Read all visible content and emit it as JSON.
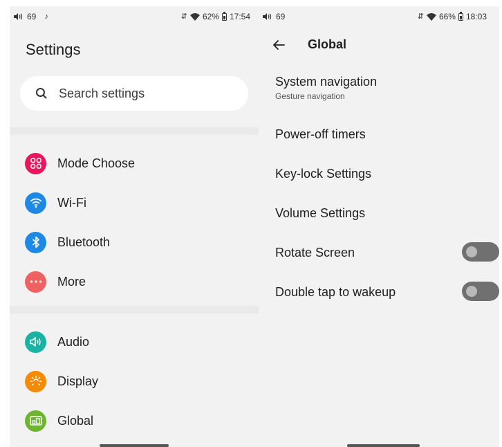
{
  "left_screen": {
    "status": {
      "volume": "69",
      "battery": "62%",
      "time": "17:54"
    },
    "title": "Settings",
    "search": {
      "placeholder": "Search settings"
    },
    "items": [
      {
        "label": "Mode Choose",
        "icon": "grid-icon",
        "color": "#e8175d"
      },
      {
        "label": "Wi-Fi",
        "icon": "wifi-icon",
        "color": "#1e88e5"
      },
      {
        "label": "Bluetooth",
        "icon": "bluetooth-icon",
        "color": "#1e88e5"
      },
      {
        "label": "More",
        "icon": "more-icon",
        "color": "#f06262"
      },
      {
        "label": "Audio",
        "icon": "speaker-icon",
        "color": "#19b2a3"
      },
      {
        "label": "Display",
        "icon": "brightness-icon",
        "color": "#f58a07"
      },
      {
        "label": "Global",
        "icon": "global-icon",
        "color": "#6cb52c"
      }
    ]
  },
  "right_screen": {
    "status": {
      "volume": "69",
      "battery": "66%",
      "time": "18:03"
    },
    "title": "Global",
    "items": [
      {
        "title": "System navigation",
        "subtitle": "Gesture navigation"
      },
      {
        "title": "Power-off timers"
      },
      {
        "title": "Key-lock Settings"
      },
      {
        "title": "Volume Settings"
      },
      {
        "title": "Rotate Screen",
        "toggle": false
      },
      {
        "title": "Double tap to wakeup",
        "toggle": false
      }
    ]
  }
}
